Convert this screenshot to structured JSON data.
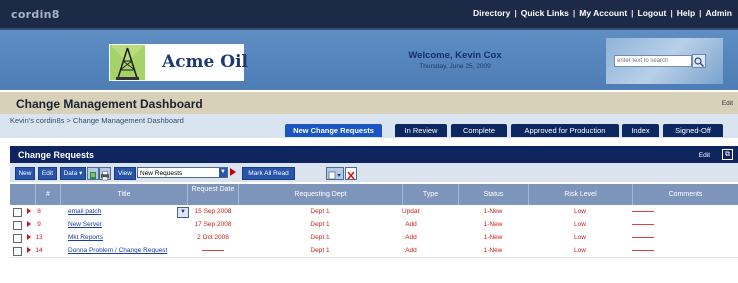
{
  "app": {
    "name": "cordin8"
  },
  "top_links": [
    "Directory",
    "Quick Links",
    "My Account",
    "Logout",
    "Help",
    "Admin"
  ],
  "banner": {
    "logo_text": "Acme Oil",
    "welcome": "Welcome, Kevin Cox",
    "date": "Thursday, June 25, 2009",
    "search_placeholder": "enter text to search"
  },
  "page": {
    "title": "Change Management Dashboard",
    "edit_label": "Edit",
    "breadcrumb": "Kevin's cordin8s > Change Management Dashboard"
  },
  "tabs": [
    {
      "label": "New Change Requests",
      "active": true
    },
    {
      "label": "In Review",
      "active": false
    },
    {
      "label": "Complete",
      "active": false
    },
    {
      "label": "Approved for Production",
      "active": false
    },
    {
      "label": "Index",
      "active": false
    },
    {
      "label": "Signed-Off",
      "active": false
    }
  ],
  "panel": {
    "title": "Change Requests",
    "edit_label": "Edit",
    "toolbar": {
      "new_label": "New",
      "edit_label": "Edit",
      "data_label": "Data ▾",
      "view_label": "View",
      "view_value": "New Requests",
      "mark_all_read": "Mark All Read"
    },
    "columns": [
      "#",
      "Title",
      "Request Date",
      "Requesting Dept",
      "Type",
      "Status",
      "Risk Level",
      "Comments"
    ],
    "rows": [
      {
        "num": "8",
        "title": "email patch",
        "date": "15 Sep 2008",
        "dept": "Dept 1",
        "type": "Update",
        "status": "1-New",
        "risk": "Low"
      },
      {
        "num": "9",
        "title": "New Server",
        "date": "17 Sep 2008",
        "dept": "Dept 1",
        "type": "Add",
        "status": "1-New",
        "risk": "Low"
      },
      {
        "num": "13",
        "title": "Mkt Reports",
        "date": "2 Oct 2008",
        "dept": "Dept 1",
        "type": "Add",
        "status": "1-New",
        "risk": "Low"
      },
      {
        "num": "14",
        "title": "Donna Problem / Change Request",
        "date": "",
        "dept": "Dept 1",
        "type": "Add",
        "status": "1-New",
        "risk": "Low"
      }
    ]
  },
  "colors": {
    "top_bar": "#1c2a48",
    "banner": "#5584bb",
    "active_tab": "#1a55c4",
    "tab": "#0d2760",
    "header_row": "#7d95bb",
    "row_text": "#cc1e1e",
    "link": "#1a3fa8"
  }
}
